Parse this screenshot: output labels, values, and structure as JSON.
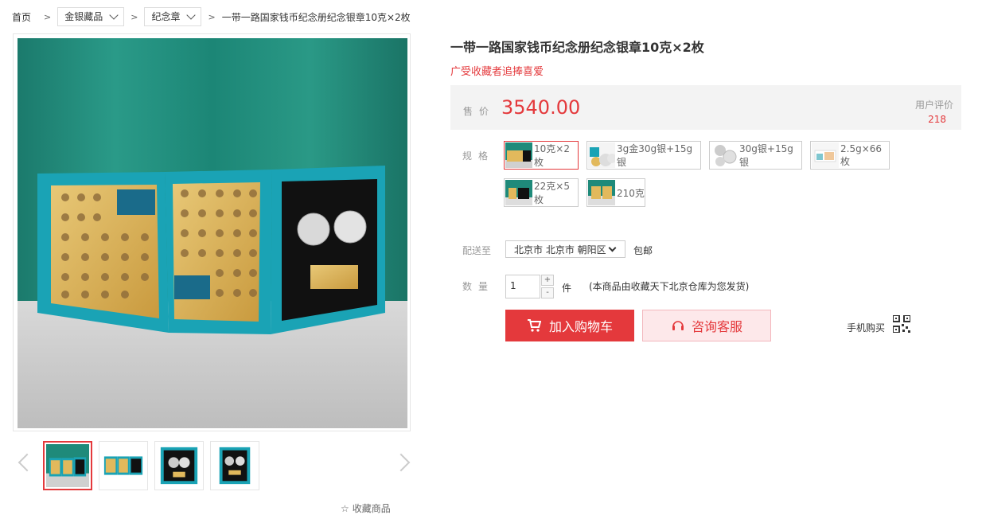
{
  "breadcrumb": {
    "home": "首页",
    "cat1": "金银藏品",
    "cat2": "纪念章",
    "current": "一带一路国家钱币纪念册纪念银章10克×2枚"
  },
  "product": {
    "title": "一带一路国家钱币纪念册纪念银章10克×2枚",
    "slogan": "广受收藏者追捧喜爱",
    "price_label": "售价",
    "price": "3540.00",
    "review_label": "用户评价",
    "review_count": "218"
  },
  "spec": {
    "label": "规格",
    "options": [
      "10克×2枚",
      "3g金30g银+15g银",
      "30g银+15g银",
      "2.5g×66枚",
      "22克×5枚",
      "210克"
    ],
    "selected_index": 0
  },
  "delivery": {
    "label": "配送至",
    "region": "北京市 北京市 朝阳区",
    "shipping": "包邮"
  },
  "quantity": {
    "label": "数量",
    "value": "1",
    "plus": "+",
    "minus": "-",
    "unit": "件",
    "note": "(本商品由收藏天下北京仓库为您发货)"
  },
  "actions": {
    "add_cart": "加入购物车",
    "service": "咨询客服",
    "mobile_buy": "手机购买"
  },
  "gallery": {
    "favorite": "收藏商品",
    "thumbnail_count": 4,
    "active_thumbnail": 0
  },
  "colors": {
    "accent": "#e4393c",
    "teal_bg": "#1f8a7a",
    "album": "#1aa3b5"
  }
}
